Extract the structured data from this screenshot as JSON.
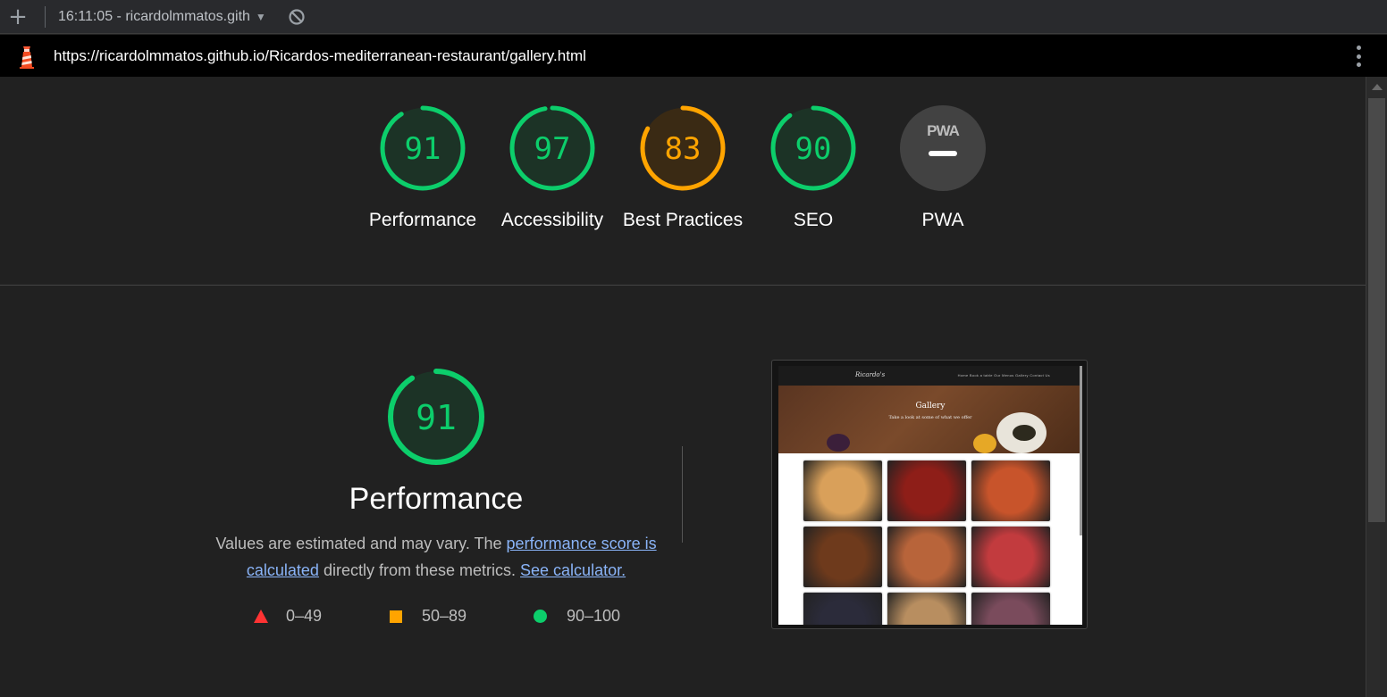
{
  "toolbar": {
    "plus": "+",
    "title": "16:11:05 - ricardolmmatos.gith",
    "caret": "▼"
  },
  "urlbar": {
    "url": "https://ricardolmmatos.github.io/Ricardos-mediterranean-restaurant/gallery.html"
  },
  "colors": {
    "pass": "#0cce6b",
    "average": "#ffa400",
    "fail": "#ff3333",
    "link": "#8ab4f8"
  },
  "scores": [
    {
      "label": "Performance",
      "value": "91",
      "percent": 91,
      "status": "pass"
    },
    {
      "label": "Accessibility",
      "value": "97",
      "percent": 97,
      "status": "pass"
    },
    {
      "label": "Best Practices",
      "value": "83",
      "percent": 83,
      "status": "average"
    },
    {
      "label": "SEO",
      "value": "90",
      "percent": 90,
      "status": "pass"
    },
    {
      "label": "PWA",
      "icon_text": "PWA",
      "status": "na"
    }
  ],
  "performance": {
    "score": "91",
    "percent": 91,
    "title": "Performance",
    "desc_before": "Values are estimated and may vary. The ",
    "link_score": "performance score is calculated",
    "desc_middle": " directly from these metrics. ",
    "link_calc": "See calculator.",
    "legend": {
      "fail": "0–49",
      "average": "50–89",
      "pass": "90–100"
    }
  },
  "thumbnail": {
    "brand": "Ricardo's",
    "nav": "Home    Book a table    Our Menus    Gallery    Contact Us",
    "hero_title": "Gallery",
    "hero_sub": "Take a look at some of what we offer",
    "cell_colors": [
      "#d9a05a",
      "#8e1e18",
      "#c8542b",
      "#6e3a1c",
      "#b8643a",
      "#c23b3e",
      "#2b2b3a",
      "#b88e60",
      "#7a4b5c"
    ]
  }
}
